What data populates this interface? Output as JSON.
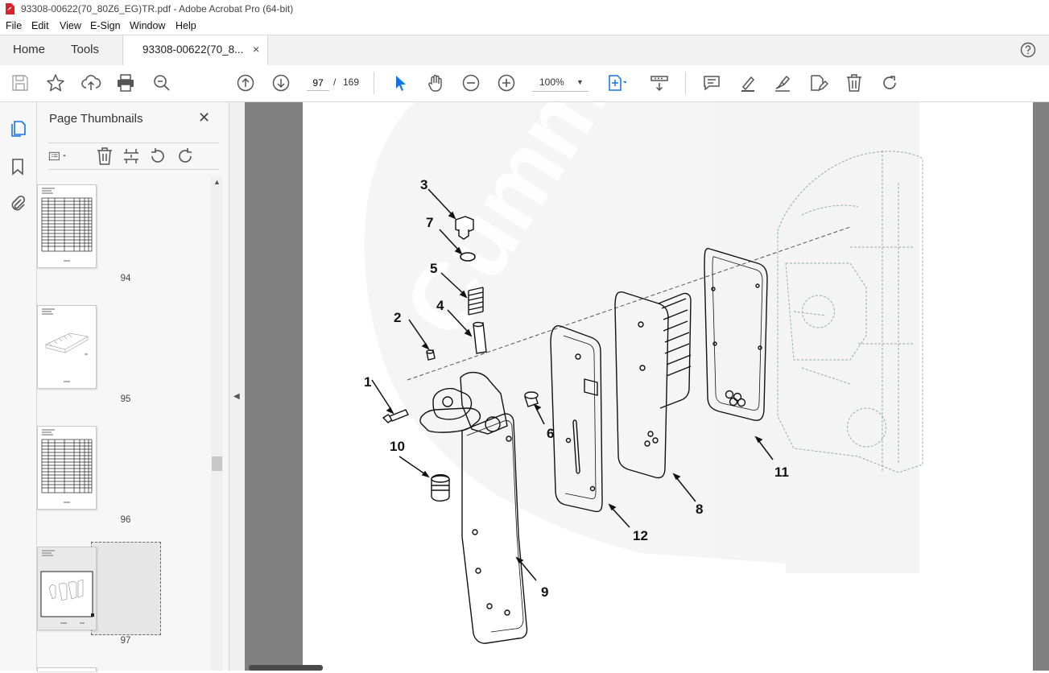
{
  "window": {
    "title": "93308-00622(70_80Z6_EG)TR.pdf - Adobe Acrobat Pro (64-bit)"
  },
  "menu": [
    "File",
    "Edit",
    "View",
    "E-Sign",
    "Window",
    "Help"
  ],
  "tabs": {
    "home": "Home",
    "tools": "Tools",
    "document": "93308-00622(70_8...",
    "close": "×"
  },
  "toolbar": {
    "page_current": "97",
    "page_separator": "/",
    "page_total": "169",
    "zoom": "100%",
    "icons": [
      "save-icon",
      "star-icon",
      "upload-icon",
      "print-icon",
      "search-zoom-icon",
      "page-up-icon",
      "page-down-icon",
      "select-arrow-icon",
      "hand-icon",
      "zoom-out-icon",
      "zoom-in-icon",
      "fit-page-icon",
      "scroll-mode-icon",
      "comment-icon",
      "highlight-icon",
      "sign-icon",
      "edit-pdf-icon",
      "delete-icon",
      "rotate-icon"
    ]
  },
  "sidebar": {
    "title": "Page Thumbnails",
    "close": "✕",
    "thumbnails": [
      {
        "label": "94",
        "kind": "table"
      },
      {
        "label": "95",
        "kind": "drawing"
      },
      {
        "label": "96",
        "kind": "table"
      },
      {
        "label": "97",
        "kind": "selected"
      }
    ]
  },
  "diagram": {
    "watermark": "Cummins",
    "callouts": [
      "1",
      "2",
      "3",
      "4",
      "5",
      "6",
      "7",
      "8",
      "9",
      "10",
      "11",
      "12"
    ]
  },
  "colors": {
    "accent": "#1473e6",
    "tabbar": "#f2f2f2",
    "docbg": "#808080"
  }
}
